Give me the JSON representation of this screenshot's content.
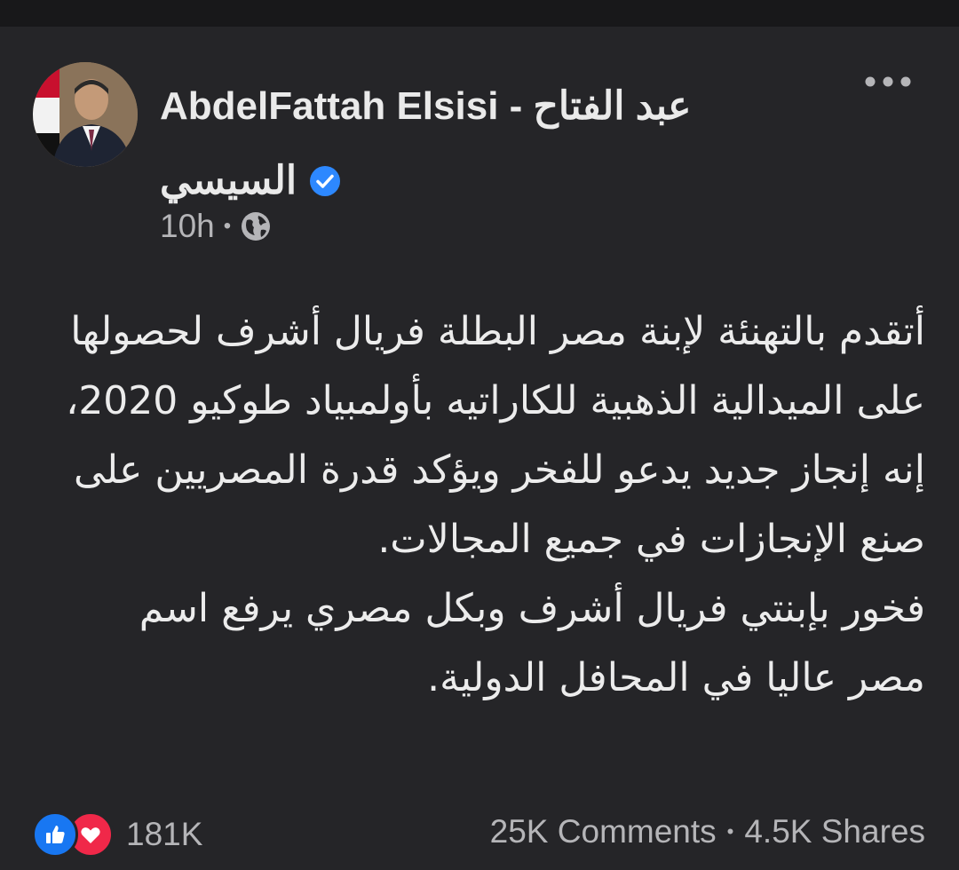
{
  "post": {
    "author_name_line1": "AbdelFattah Elsisi - عبد الفتاح",
    "author_name_line2": "السيسي",
    "time": "10h",
    "separator": "•",
    "privacy_icon": "globe-icon",
    "verified_icon": "verified-badge-icon",
    "more_icon": "more-options-icon",
    "paragraph_1": "أتقدم بالتهنئة لإبنة مصر البطلة فريال أشرف لحصولها على الميدالية الذهبية للكاراتيه بأولمبياد طوكيو 2020، إنه إنجاز جديد يدعو للفخر ويؤكد قدرة المصريين على صنع الإنجازات في جميع المجالات.",
    "paragraph_2": " فخور بإبنتي فريال أشرف وبكل مصري يرفع اسم مصر عاليا في المحافل الدولية."
  },
  "footer": {
    "reaction_count": "181K",
    "comments": "25K Comments",
    "separator": "•",
    "shares": "4.5K Shares",
    "reaction_icons": [
      "like-icon",
      "love-icon"
    ]
  },
  "colors": {
    "background": "#252528",
    "like_blue": "#1877f2",
    "love_red": "#f02849",
    "verified_blue": "#2d88ff",
    "muted_text": "#b5b5b8"
  }
}
